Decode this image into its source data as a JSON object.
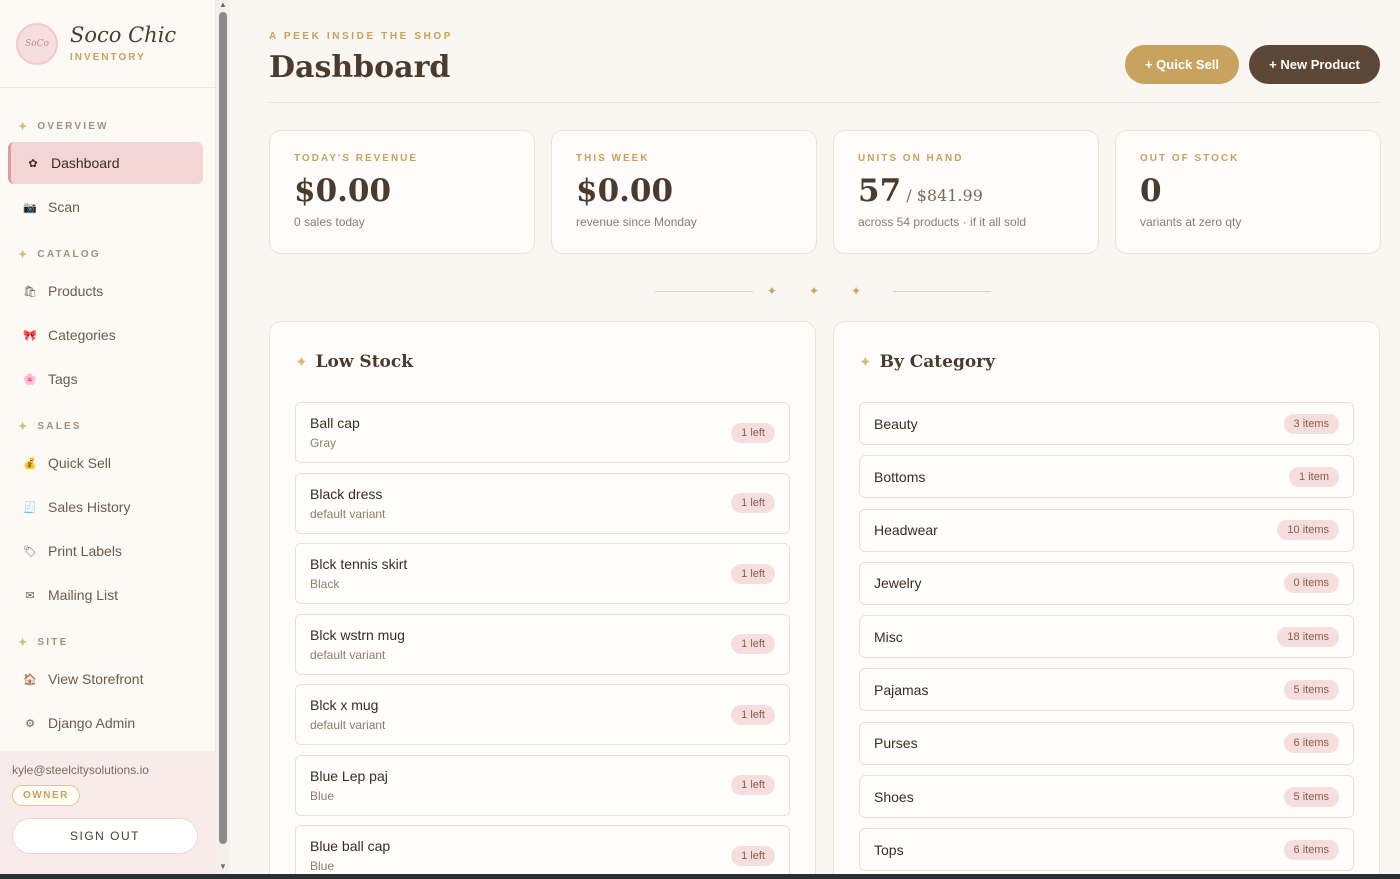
{
  "brand": {
    "name": "Soco Chic",
    "subtitle": "INVENTORY",
    "logo_text": "SoCo"
  },
  "sidebar": {
    "sections": [
      {
        "title": "OVERVIEW",
        "items": [
          {
            "label": "Dashboard",
            "icon": "dashboard-icon",
            "glyph": "✿",
            "active": true
          },
          {
            "label": "Scan",
            "icon": "camera-icon",
            "glyph": "📷"
          }
        ]
      },
      {
        "title": "CATALOG",
        "items": [
          {
            "label": "Products",
            "icon": "products-icon",
            "glyph": "🛍"
          },
          {
            "label": "Categories",
            "icon": "ribbon-icon",
            "glyph": "🎀"
          },
          {
            "label": "Tags",
            "icon": "flower-icon",
            "glyph": "🌸"
          }
        ]
      },
      {
        "title": "SALES",
        "items": [
          {
            "label": "Quick Sell",
            "icon": "money-bag-icon",
            "glyph": "💰"
          },
          {
            "label": "Sales History",
            "icon": "receipt-icon",
            "glyph": "🧾"
          },
          {
            "label": "Print Labels",
            "icon": "label-icon",
            "glyph": "🏷"
          },
          {
            "label": "Mailing List",
            "icon": "envelope-icon",
            "glyph": "✉"
          }
        ]
      },
      {
        "title": "SITE",
        "items": [
          {
            "label": "View Storefront",
            "icon": "house-icon",
            "glyph": "🏠"
          },
          {
            "label": "Django Admin",
            "icon": "gear-icon",
            "glyph": "⚙"
          }
        ]
      }
    ],
    "user": {
      "email": "kyle@steelcitysolutions.io",
      "role": "OWNER",
      "sign_out": "SIGN OUT"
    }
  },
  "header": {
    "eyebrow": "A PEEK INSIDE THE SHOP",
    "title": "Dashboard",
    "quick_sell": "+ Quick Sell",
    "new_product": "+ New Product"
  },
  "stats": [
    {
      "label": "TODAY'S REVENUE",
      "value": "$0.00",
      "extra": "",
      "sub": "0 sales today"
    },
    {
      "label": "THIS WEEK",
      "value": "$0.00",
      "extra": "",
      "sub": "revenue since Monday"
    },
    {
      "label": "UNITS ON HAND",
      "value": "57",
      "extra": " / $841.99",
      "sub": "across 54 products · if it all sold"
    },
    {
      "label": "OUT OF STOCK",
      "value": "0",
      "extra": "",
      "sub": "variants at zero qty"
    }
  ],
  "low_stock": {
    "title": "Low Stock",
    "items": [
      {
        "name": "Ball cap",
        "variant": "Gray",
        "qty": "1 left"
      },
      {
        "name": "Black dress",
        "variant": "default variant",
        "qty": "1 left"
      },
      {
        "name": "Blck tennis skirt",
        "variant": "Black",
        "qty": "1 left"
      },
      {
        "name": "Blck wstrn mug",
        "variant": "default variant",
        "qty": "1 left"
      },
      {
        "name": "Blck x mug",
        "variant": "default variant",
        "qty": "1 left"
      },
      {
        "name": "Blue Lep paj",
        "variant": "Blue",
        "qty": "1 left"
      },
      {
        "name": "Blue ball cap",
        "variant": "Blue",
        "qty": "1 left"
      }
    ]
  },
  "by_category": {
    "title": "By Category",
    "items": [
      {
        "name": "Beauty",
        "count": "3 items"
      },
      {
        "name": "Bottoms",
        "count": "1 item"
      },
      {
        "name": "Headwear",
        "count": "10 items"
      },
      {
        "name": "Jewelry",
        "count": "0 items"
      },
      {
        "name": "Misc",
        "count": "18 items"
      },
      {
        "name": "Pajamas",
        "count": "5 items"
      },
      {
        "name": "Purses",
        "count": "6 items"
      },
      {
        "name": "Shoes",
        "count": "5 items"
      },
      {
        "name": "Tops",
        "count": "6 items"
      }
    ]
  },
  "colors": {
    "accent_gold": "#c8a35f",
    "dark_brown": "#5c4636",
    "pink": "#f3d5d5",
    "background": "#faf6f1"
  }
}
